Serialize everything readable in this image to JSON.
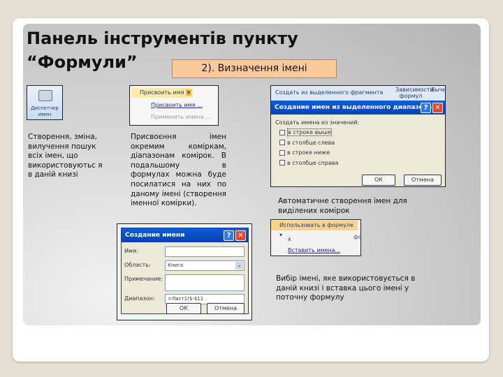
{
  "slide": {
    "title_line1": "Панель інструментів пункту",
    "title_line2": "“Формули”",
    "badge": "2). Визначення імені"
  },
  "name_manager": {
    "label": "Диспетчер имен",
    "icon": "name-manager-icon"
  },
  "assign_menu": {
    "button": "Присвоить имя",
    "items": [
      "Присвоить имя ...",
      "Применить имена ..."
    ]
  },
  "create_from_selection": {
    "ribbon_button": "Создать из выделенного фрагмента",
    "ribbon_right": "Зависимости формул",
    "ribbon_far": "Вычи",
    "dialog_title": "Создание имен из выделенного диапазона",
    "group_label": "Создать имена из значений:",
    "options": [
      "в строке выше",
      "в столбце слева",
      "в строке ниже",
      "в столбце справа"
    ],
    "ok": "ОК",
    "cancel": "Отмена"
  },
  "create_name_dialog": {
    "title": "Создание имени",
    "name_label": "Имя:",
    "name_value": "",
    "scope_label": "Область:",
    "scope_value": "Книга",
    "comment_label": "Примечание:",
    "range_label": "Диапазон:",
    "range_value": "=Лист1!$-$11",
    "ok": "ОК",
    "cancel": "Отмена"
  },
  "use_in_formula": {
    "button": "Использовать в формуле",
    "items": [
      "x",
      "Вставить имена..."
    ],
    "side": "фо"
  },
  "texts": {
    "name_manager_desc": "Створення, зміна, вилучення пошук всіх імен, що використовуютьс я в даній книзі",
    "assign_desc": "Присвоєння імен окремим коміркам, діапазонам комірок. В подальшому в формулах можна буде посилатися на них по даному імені (створення іменної комірки).",
    "auto_desc": "Автоматичне створення імен для виділених комірок",
    "use_desc": "Вибір імені, яке використовується в даній книзі і вставка цього імені у поточну формулу"
  }
}
